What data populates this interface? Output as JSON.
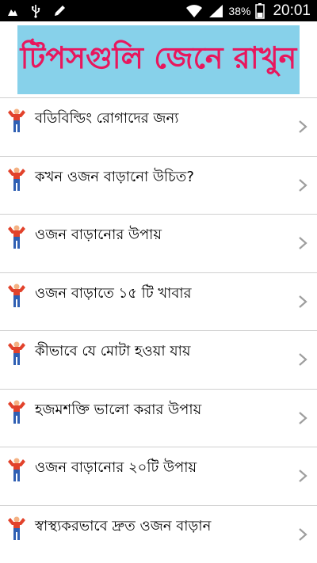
{
  "status_bar": {
    "icons": [
      "notification-icon",
      "usb-icon",
      "edit-icon",
      "wifi-icon",
      "signal-icon",
      "battery-icon"
    ],
    "battery": "38%",
    "time": "20:01"
  },
  "banner": {
    "text": "টিপসগুলি জেনে রাখুন",
    "bg_color": "#87d1ea",
    "text_color": "#e8175d"
  },
  "list": {
    "items": [
      {
        "label": "বডিবিল্ডিং রোগাদের জন্য"
      },
      {
        "label": "কখন ওজন বাড়ানো উচিত?"
      },
      {
        "label": "ওজন বাড়ানোর উপায়"
      },
      {
        "label": "ওজন বাড়াতে ১৫ টি খাবার"
      },
      {
        "label": "কীভাবে যে মোটা হওয়া যায়"
      },
      {
        "label": "হজমশক্তি ভালো করার উপায়"
      },
      {
        "label": "ওজন বাড়ানোর ২০টি উপায়"
      },
      {
        "label": "স্বাস্থ্যকরভাবে দ্রুত ওজন বাড়ান"
      }
    ]
  }
}
